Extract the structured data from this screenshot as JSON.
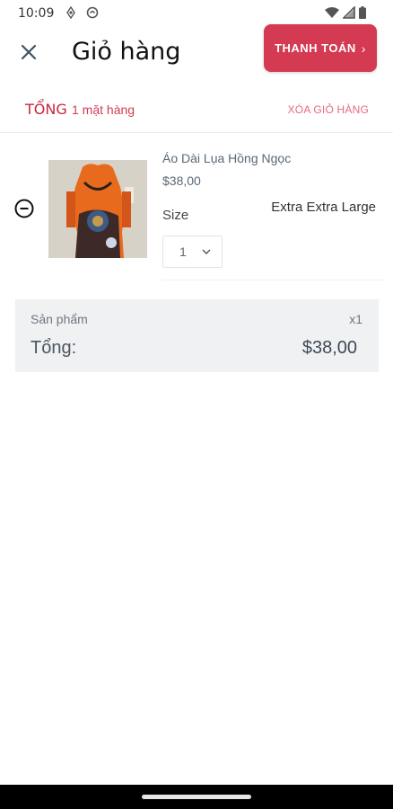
{
  "status_bar": {
    "time": "10:09",
    "icons": [
      "nfc-icon",
      "shield-icon",
      "wifi-icon",
      "cell-signal-icon",
      "battery-icon"
    ]
  },
  "header": {
    "close_icon": "close-icon",
    "title": "Giỏ hàng",
    "checkout_label": "THANH TOÁN",
    "checkout_color": "#d43a52"
  },
  "summary": {
    "total_label": "TỔNG",
    "item_count": "1 mặt hàng",
    "clear_label": "XÓA GIỎ HÀNG"
  },
  "cart": {
    "items": [
      {
        "name": "Áo Dài Lụa Hồng Ngọc",
        "price": "$38,00",
        "size_label": "Size",
        "size_value": "Extra Extra Large",
        "quantity": "1"
      }
    ]
  },
  "totals": {
    "products_label": "Sản phẩm",
    "products_count": "x1",
    "grand_label": "Tổng:",
    "grand_value": "$38,00"
  }
}
